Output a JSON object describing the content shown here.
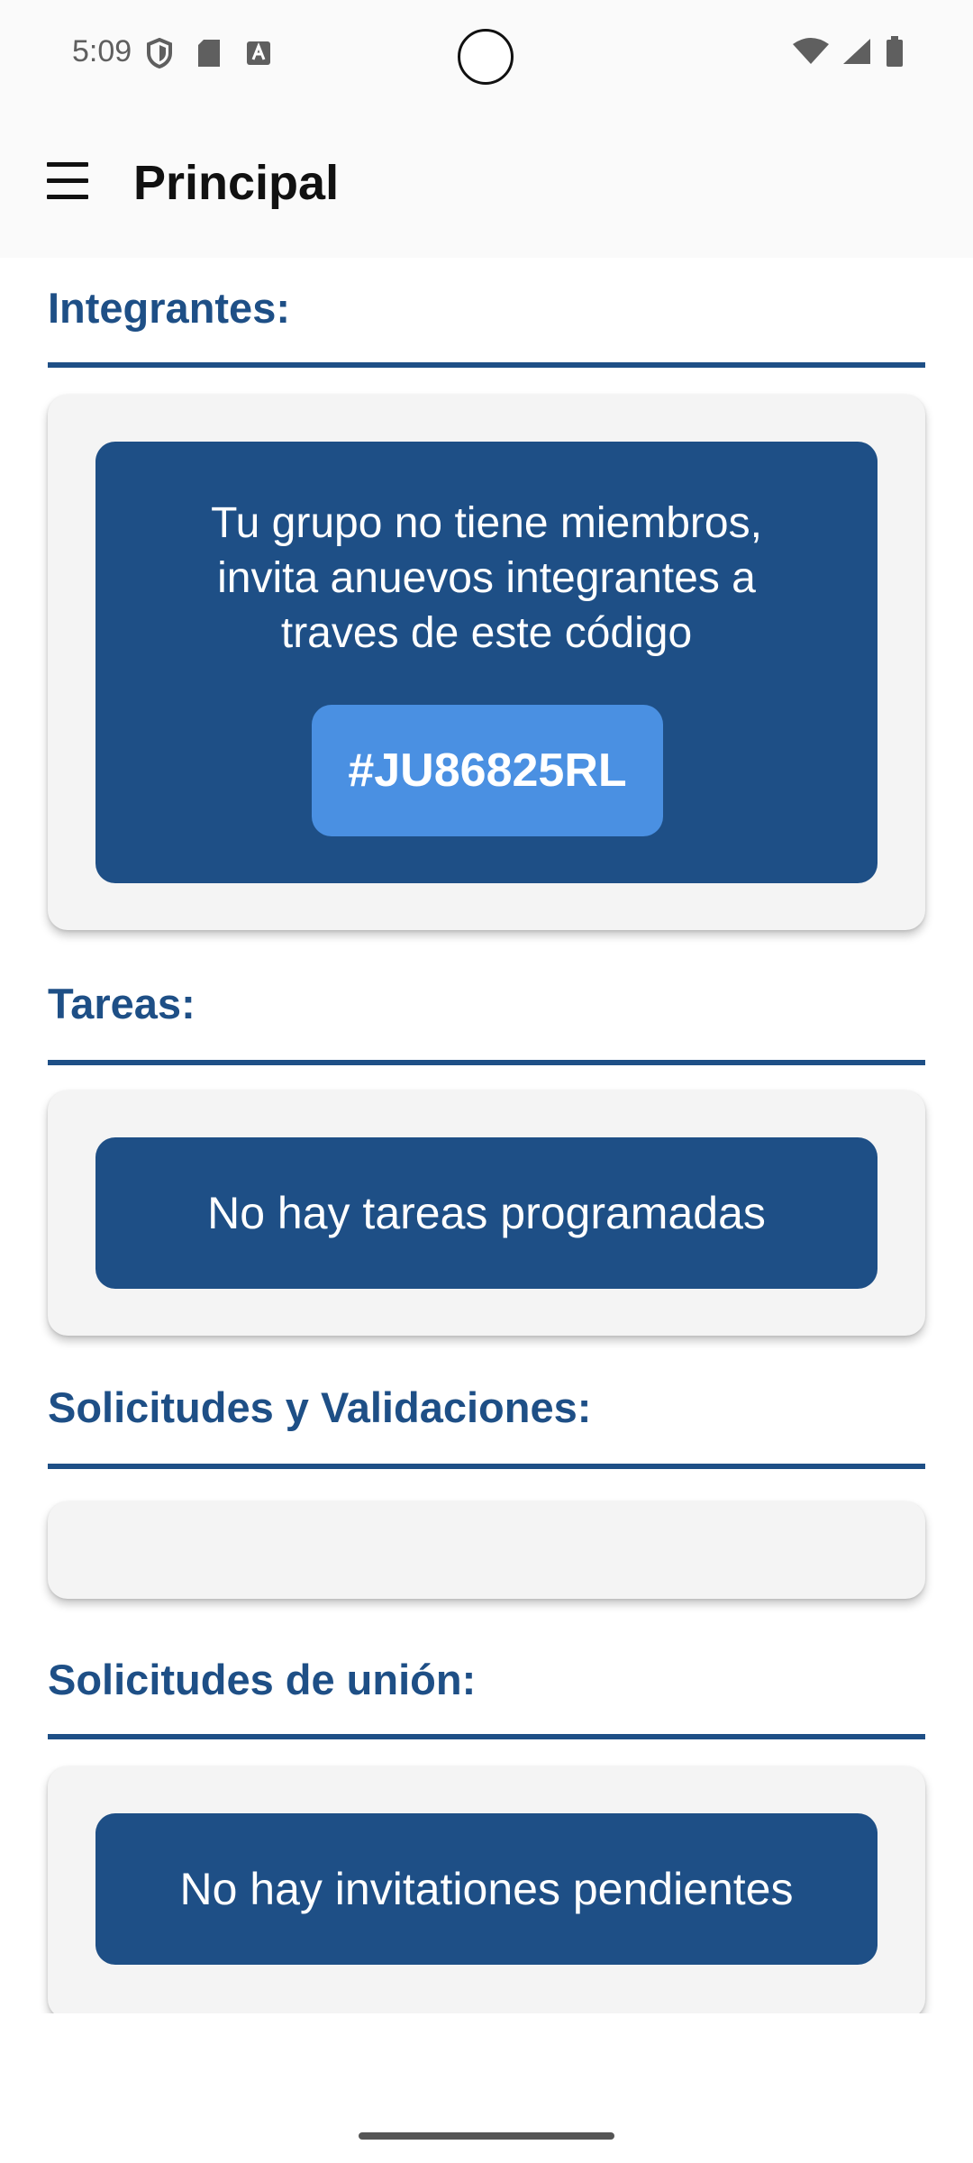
{
  "status_bar": {
    "time": "5:09",
    "left_icons": [
      "shield-icon",
      "sd-card-icon",
      "keyboard-a-icon"
    ],
    "right_icons": [
      "wifi-icon",
      "cell-signal-icon",
      "battery-icon"
    ]
  },
  "app_bar": {
    "title": "Principal",
    "menu_icon": "hamburger-menu-icon"
  },
  "sections": {
    "members": {
      "title": "Integrantes:",
      "message": "Tu grupo no tiene miembros, invita anuevos integrantes a traves de este código",
      "code": "#JU86825RL"
    },
    "tasks": {
      "title": "Tareas:",
      "message": "No hay tareas programadas"
    },
    "requests": {
      "title": "Solicitudes y Validaciones:"
    },
    "join": {
      "title": "Solicitudes de unión:",
      "message": "No hay invitationes pendientes"
    }
  },
  "colors": {
    "primary": "#1e4f86",
    "accent": "#4a90e2",
    "card": "#f4f4f4"
  }
}
